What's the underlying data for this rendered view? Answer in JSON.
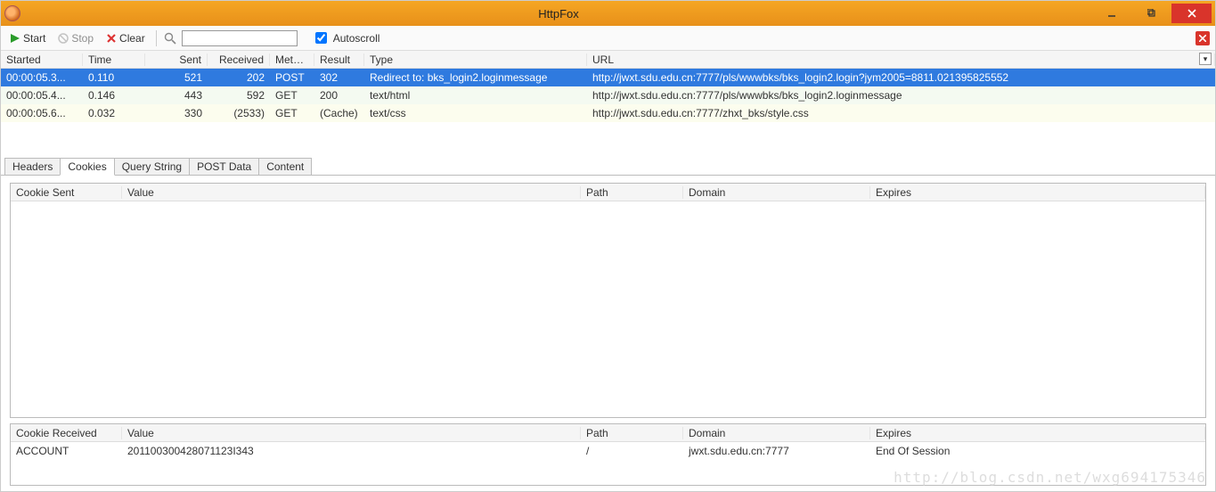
{
  "window": {
    "title": "HttpFox"
  },
  "toolbar": {
    "start": "Start",
    "stop": "Stop",
    "clear": "Clear",
    "filter_value": "",
    "autoscroll_label": "Autoscroll",
    "autoscroll_checked": true
  },
  "request_columns": {
    "started": "Started",
    "time": "Time",
    "sent": "Sent",
    "received": "Received",
    "method": "Method",
    "result": "Result",
    "type": "Type",
    "url": "URL"
  },
  "requests": [
    {
      "started": "00:00:05.3...",
      "time": "0.110",
      "sent": "521",
      "received": "202",
      "method": "POST",
      "result": "302",
      "type": "Redirect to: bks_login2.loginmessage",
      "url": "http://jwxt.sdu.edu.cn:7777/pls/wwwbks/bks_login2.login?jym2005=8811.021395825552",
      "selected": true
    },
    {
      "started": "00:00:05.4...",
      "time": "0.146",
      "sent": "443",
      "received": "592",
      "method": "GET",
      "result": "200",
      "type": "text/html",
      "url": "http://jwxt.sdu.edu.cn:7777/pls/wwwbks/bks_login2.loginmessage"
    },
    {
      "started": "00:00:05.6...",
      "time": "0.032",
      "sent": "330",
      "received": "(2533)",
      "method": "GET",
      "result": "(Cache)",
      "type": "text/css",
      "url": "http://jwxt.sdu.edu.cn:7777/zhxt_bks/style.css"
    }
  ],
  "tabs": {
    "headers": "Headers",
    "cookies": "Cookies",
    "query": "Query String",
    "postdata": "POST Data",
    "content": "Content",
    "active": "cookies"
  },
  "cookie_columns": {
    "sent_label": "Cookie Sent",
    "recv_label": "Cookie Received",
    "value": "Value",
    "path": "Path",
    "domain": "Domain",
    "expires": "Expires"
  },
  "cookies_sent": [],
  "cookies_received": [
    {
      "name": "ACCOUNT",
      "value": "201100300428071123I343",
      "path": "/",
      "domain": "jwxt.sdu.edu.cn:7777",
      "expires": "End Of Session"
    }
  ],
  "watermark": "http://blog.csdn.net/wxg694175346"
}
